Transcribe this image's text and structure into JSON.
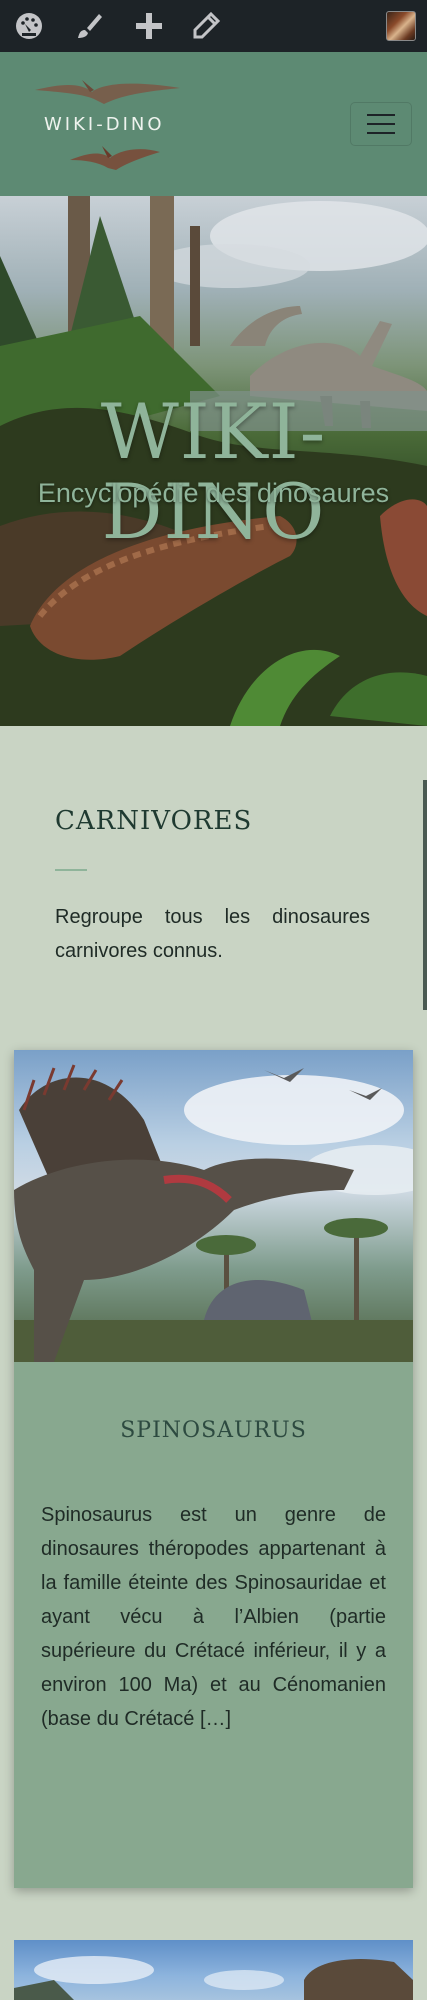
{
  "adminbar": {
    "icons": [
      "dashboard-icon",
      "brush-icon",
      "plus-icon",
      "pencil-icon"
    ],
    "avatar": "user-avatar"
  },
  "header": {
    "logo_text": "WIKI-DINO",
    "menu_icon": "hamburger-icon"
  },
  "hero": {
    "title": "WIKI-DINO",
    "subtitle": "Encyclopédie des dinosaures"
  },
  "intro": {
    "title": "CARNIVORES",
    "description": "Regroupe tous les dinosaures carnivores connus."
  },
  "cards": [
    {
      "title": "SPINOSAURUS",
      "excerpt": "Spinosaurus est un genre de dinosaures théropodes appartenant à la famille éteinte des Spinosauridae et ayant vécu à l’Albien (partie supérieure du Crétacé inférieur, il y a environ 100 Ma) et au Cénomanien (base du Crétacé […]"
    }
  ],
  "colors": {
    "adminbar": "#1d2327",
    "header": "#5d8a73",
    "page_bg": "#c9d4c4",
    "card_bg": "#88a88f",
    "accent": "#8fb49a"
  }
}
